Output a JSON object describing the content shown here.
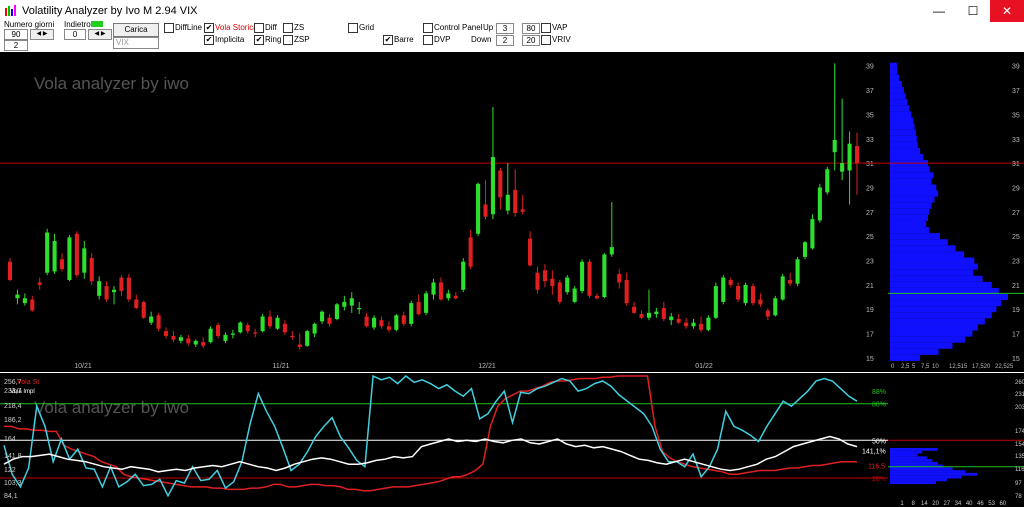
{
  "window": {
    "title": "Volatility Analyzer by Ivo M 2.94  VIX",
    "minimize": "—",
    "maximize": "☐",
    "close": "✕"
  },
  "toolbar": {
    "numero_giorni_label": "Numero giorni",
    "numero_giorni_value": "90",
    "numero_giorni_second": "2",
    "indietro_label": "Indietro",
    "indietro_value": "0",
    "carica_label": "Carica",
    "symbol_placeholder": "VIX",
    "checkboxes": [
      {
        "label": "DiffLine",
        "checked": false,
        "color": "#000000"
      },
      {
        "label": "Vola Storica",
        "checked": true,
        "color": "#e00000"
      },
      {
        "label": "Implicita",
        "checked": true,
        "color": "#000000"
      },
      {
        "label": "Diff",
        "checked": false,
        "color": "#000000"
      },
      {
        "label": "Ring",
        "checked": true,
        "color": "#000000"
      },
      {
        "label": "ZS",
        "checked": false,
        "color": "#000000"
      },
      {
        "label": "ZSP",
        "checked": false,
        "color": "#000000"
      },
      {
        "label": "Grid",
        "checked": false,
        "color": "#000000"
      },
      {
        "label": "Barre",
        "checked": true,
        "color": "#000000"
      },
      {
        "label": "Control Panel",
        "checked": false,
        "color": "#000000"
      },
      {
        "label": "DVP",
        "checked": false,
        "color": "#000000"
      },
      {
        "label": "VAP",
        "checked": false,
        "color": "#000000"
      },
      {
        "label": "VRIV",
        "checked": false,
        "color": "#000000"
      }
    ],
    "up_label": "Up",
    "up_value": "3",
    "up_value2": "80",
    "down_label": "Down",
    "down_value": "2",
    "down_value2": "20"
  },
  "main_chart": {
    "watermark": "Vola analyzer by iwo",
    "y_ticks": [
      "39",
      "37",
      "35",
      "33",
      "31",
      "29",
      "27",
      "25",
      "23",
      "21",
      "19",
      "17",
      "15"
    ],
    "x_labels": [
      "10/21",
      "11/21",
      "12/21",
      "01/22"
    ],
    "current_line_value": 31,
    "secondary_line_value": 20.3,
    "ylim": [
      14.5,
      39.8
    ]
  },
  "profile_chart": {
    "x_ticks": [
      "0",
      "2,5",
      "5",
      "7,5",
      "10",
      "12,515",
      "17,520",
      "22,525"
    ]
  },
  "lower_chart": {
    "watermark": "Vola analyzer by iwo",
    "legend_storica": "Vola St",
    "legend_storica_val": "256,7",
    "legend_implicita": "Vola Impl",
    "y_ticks_left": [
      "256,7",
      "233,7",
      "218,4",
      "186,2",
      "164",
      "141,8",
      "122",
      "103,3",
      "84,1"
    ],
    "pct_labels": [
      "88%",
      "80%",
      "50%",
      "20%"
    ],
    "value_label_white": "141,1%",
    "value_label_red": "116,5",
    "y_ticks_right": [
      "260",
      "231",
      "203",
      "174",
      "154",
      "135",
      "116",
      "97",
      "78"
    ],
    "hist_x_ticks": [
      "1",
      "8",
      "14",
      "20",
      "27",
      "34",
      "40",
      "46",
      "53",
      "60"
    ]
  },
  "colors": {
    "up": "#2ee02e",
    "down": "#e02020",
    "profile": "#1010ff",
    "iv": "#40d0e0",
    "hv": "#e02020",
    "ring": "#ffffff",
    "ref_red": "#c00000",
    "ref_green": "#20c020"
  },
  "chart_data": {
    "type": "candlestick",
    "candles": [
      [
        22.9,
        23.2,
        21.3,
        21.4
      ],
      [
        19.9,
        20.6,
        19.4,
        20.2
      ],
      [
        19.5,
        20.3,
        19.3,
        19.9
      ],
      [
        19.8,
        20.1,
        18.8,
        18.9
      ],
      [
        21.2,
        21.6,
        20.6,
        21.0
      ],
      [
        22.0,
        25.6,
        21.8,
        25.3
      ],
      [
        22.1,
        25.2,
        21.9,
        24.6
      ],
      [
        23.1,
        23.6,
        22.1,
        22.3
      ],
      [
        21.4,
        25.1,
        21.3,
        24.9
      ],
      [
        25.2,
        25.4,
        21.6,
        21.8
      ],
      [
        22.0,
        24.6,
        21.5,
        24.0
      ],
      [
        23.2,
        23.6,
        21.0,
        21.3
      ],
      [
        20.1,
        21.7,
        19.8,
        21.3
      ],
      [
        20.9,
        21.3,
        19.6,
        19.8
      ],
      [
        20.4,
        20.9,
        19.4,
        20.6
      ],
      [
        21.6,
        21.8,
        20.1,
        20.5
      ],
      [
        21.6,
        21.9,
        19.6,
        19.8
      ],
      [
        19.8,
        20.2,
        19.0,
        19.1
      ],
      [
        19.6,
        19.7,
        18.2,
        18.3
      ],
      [
        17.9,
        18.8,
        17.7,
        18.4
      ],
      [
        18.5,
        18.7,
        17.2,
        17.4
      ],
      [
        17.2,
        17.5,
        16.6,
        16.8
      ],
      [
        16.8,
        17.2,
        16.3,
        16.5
      ],
      [
        16.4,
        16.9,
        16.2,
        16.7
      ],
      [
        16.6,
        16.9,
        16.0,
        16.2
      ],
      [
        16.1,
        16.5,
        15.9,
        16.4
      ],
      [
        16.3,
        16.7,
        15.8,
        16.0
      ],
      [
        16.3,
        17.6,
        16.2,
        17.4
      ],
      [
        17.7,
        17.9,
        16.6,
        16.8
      ],
      [
        16.4,
        17.1,
        16.2,
        16.9
      ],
      [
        16.9,
        17.3,
        16.6,
        17.0
      ],
      [
        17.1,
        18.0,
        17.0,
        17.9
      ],
      [
        17.7,
        17.9,
        17.0,
        17.2
      ],
      [
        17.1,
        17.4,
        16.7,
        17.0
      ],
      [
        17.2,
        18.6,
        17.1,
        18.4
      ],
      [
        18.4,
        18.9,
        17.4,
        17.6
      ],
      [
        17.4,
        18.5,
        17.3,
        18.3
      ],
      [
        17.8,
        18.1,
        16.9,
        17.1
      ],
      [
        16.8,
        17.2,
        16.5,
        16.7
      ],
      [
        16.1,
        17.0,
        15.7,
        15.9
      ],
      [
        16.0,
        17.3,
        15.9,
        17.2
      ],
      [
        17.0,
        17.9,
        16.7,
        17.8
      ],
      [
        18.0,
        18.9,
        17.8,
        18.8
      ],
      [
        18.3,
        18.6,
        17.6,
        17.8
      ],
      [
        18.2,
        19.5,
        18.1,
        19.4
      ],
      [
        19.2,
        20.1,
        18.9,
        19.6
      ],
      [
        19.3,
        20.4,
        18.7,
        19.9
      ],
      [
        19.0,
        19.6,
        18.6,
        19.1
      ],
      [
        18.4,
        18.7,
        17.5,
        17.6
      ],
      [
        17.5,
        18.5,
        17.3,
        18.3
      ],
      [
        18.1,
        18.4,
        17.4,
        17.6
      ],
      [
        17.6,
        18.0,
        17.1,
        17.3
      ],
      [
        17.3,
        18.6,
        17.2,
        18.5
      ],
      [
        18.5,
        18.8,
        17.6,
        17.8
      ],
      [
        17.8,
        19.7,
        17.6,
        19.5
      ],
      [
        19.6,
        20.2,
        18.5,
        18.6
      ],
      [
        18.7,
        20.5,
        18.5,
        20.3
      ],
      [
        20.2,
        21.5,
        19.8,
        21.2
      ],
      [
        21.2,
        21.6,
        19.7,
        19.8
      ],
      [
        19.9,
        20.6,
        19.7,
        20.3
      ],
      [
        20.1,
        20.4,
        19.8,
        19.9
      ],
      [
        20.6,
        23.2,
        20.4,
        22.9
      ],
      [
        24.9,
        25.5,
        22.3,
        22.5
      ],
      [
        25.2,
        29.4,
        25.0,
        29.3
      ],
      [
        27.6,
        29.6,
        26.4,
        26.6
      ],
      [
        26.8,
        35.6,
        26.4,
        31.5
      ],
      [
        30.4,
        30.6,
        27.2,
        28.2
      ],
      [
        27.1,
        31.0,
        26.8,
        28.4
      ],
      [
        28.8,
        30.5,
        26.6,
        26.9
      ],
      [
        27.2,
        28.4,
        26.8,
        27.0
      ],
      [
        24.8,
        25.4,
        22.5,
        22.6
      ],
      [
        22.0,
        22.5,
        20.3,
        20.6
      ],
      [
        22.2,
        22.7,
        20.8,
        21.3
      ],
      [
        21.5,
        22.2,
        20.2,
        20.9
      ],
      [
        21.2,
        21.4,
        19.4,
        19.6
      ],
      [
        20.4,
        21.8,
        20.2,
        21.6
      ],
      [
        19.6,
        20.9,
        19.5,
        20.7
      ],
      [
        20.5,
        23.1,
        20.3,
        22.9
      ],
      [
        22.9,
        23.1,
        19.9,
        20.1
      ],
      [
        20.1,
        20.3,
        19.8,
        19.9
      ],
      [
        20.0,
        23.6,
        19.9,
        23.5
      ],
      [
        23.5,
        27.8,
        23.3,
        24.1
      ],
      [
        21.9,
        22.3,
        20.7,
        21.2
      ],
      [
        21.4,
        22.0,
        19.3,
        19.5
      ],
      [
        19.2,
        19.6,
        18.6,
        18.7
      ],
      [
        18.6,
        18.9,
        18.2,
        18.3
      ],
      [
        18.3,
        20.6,
        18.1,
        18.7
      ],
      [
        18.6,
        19.1,
        18.3,
        18.8
      ],
      [
        19.1,
        19.6,
        18.0,
        18.2
      ],
      [
        18.1,
        18.7,
        17.7,
        18.4
      ],
      [
        18.2,
        18.6,
        17.8,
        17.9
      ],
      [
        17.9,
        18.3,
        17.4,
        17.6
      ],
      [
        17.6,
        18.2,
        17.4,
        17.9
      ],
      [
        17.8,
        18.4,
        17.1,
        17.3
      ],
      [
        17.3,
        18.5,
        17.2,
        18.3
      ],
      [
        18.3,
        21.2,
        18.2,
        20.9
      ],
      [
        19.6,
        21.8,
        19.4,
        21.6
      ],
      [
        21.4,
        21.6,
        20.8,
        21.0
      ],
      [
        20.9,
        21.2,
        19.6,
        19.8
      ],
      [
        19.5,
        21.2,
        19.3,
        21.0
      ],
      [
        20.9,
        21.1,
        19.3,
        19.5
      ],
      [
        19.8,
        20.3,
        19.2,
        19.4
      ],
      [
        18.9,
        19.1,
        18.1,
        18.4
      ],
      [
        18.5,
        20.1,
        18.4,
        19.9
      ],
      [
        19.8,
        21.9,
        19.7,
        21.7
      ],
      [
        21.4,
        22.0,
        20.9,
        21.1
      ],
      [
        21.1,
        23.3,
        20.9,
        23.1
      ],
      [
        23.3,
        24.6,
        23.1,
        24.5
      ],
      [
        24.0,
        26.8,
        23.9,
        26.4
      ],
      [
        26.3,
        29.3,
        26.1,
        29.0
      ],
      [
        28.6,
        30.7,
        28.4,
        30.5
      ],
      [
        31.9,
        39.2,
        30.4,
        32.9
      ],
      [
        30.3,
        36.3,
        29.6,
        31.0
      ],
      [
        30.4,
        33.6,
        27.6,
        32.6
      ],
      [
        32.4,
        33.5,
        28.4,
        31.0
      ]
    ],
    "profile": [
      [
        39.0,
        1.5
      ],
      [
        38.5,
        1.6
      ],
      [
        38.0,
        2.0
      ],
      [
        37.5,
        2.6
      ],
      [
        37.0,
        3.0
      ],
      [
        36.5,
        3.4
      ],
      [
        36.0,
        3.8
      ],
      [
        35.5,
        4.2
      ],
      [
        35.0,
        4.6
      ],
      [
        34.5,
        5.0
      ],
      [
        34.0,
        5.3
      ],
      [
        33.5,
        5.6
      ],
      [
        33.0,
        5.8
      ],
      [
        32.5,
        6.0
      ],
      [
        32.0,
        6.5
      ],
      [
        31.5,
        7.2
      ],
      [
        31.0,
        8.2
      ],
      [
        30.5,
        8.6
      ],
      [
        30.0,
        9.4
      ],
      [
        29.5,
        9.0
      ],
      [
        29.0,
        10.0
      ],
      [
        28.5,
        10.4
      ],
      [
        28.0,
        9.6
      ],
      [
        27.5,
        9.0
      ],
      [
        27.0,
        8.5
      ],
      [
        26.5,
        8.2
      ],
      [
        26.0,
        7.8
      ],
      [
        25.5,
        8.5
      ],
      [
        25.0,
        10.8
      ],
      [
        24.5,
        12.5
      ],
      [
        24.0,
        14.2
      ],
      [
        23.5,
        16.0
      ],
      [
        23.0,
        18.2
      ],
      [
        22.5,
        19.0
      ],
      [
        22.0,
        18.0
      ],
      [
        21.5,
        20.0
      ],
      [
        21.0,
        22.0
      ],
      [
        20.5,
        23.5
      ],
      [
        20.0,
        25.5
      ],
      [
        19.5,
        24.0
      ],
      [
        19.0,
        23.0
      ],
      [
        18.5,
        22.0
      ],
      [
        18.0,
        20.5
      ],
      [
        17.5,
        19.0
      ],
      [
        17.0,
        17.8
      ],
      [
        16.5,
        16.2
      ],
      [
        16.0,
        13.5
      ],
      [
        15.5,
        10.5
      ],
      [
        15.0,
        6.5
      ]
    ],
    "iv_series": [
      0.45,
      0.22,
      0.12,
      0.27,
      0.76,
      0.6,
      0.32,
      0.5,
      0.34,
      0.42,
      0.27,
      0.26,
      0.12,
      0.28,
      0.12,
      0.16,
      0.22,
      0.13,
      0.14,
      0.18,
      0.05,
      0.17,
      0.15,
      0.28,
      0.17,
      0.18,
      0.25,
      0.11,
      0.16,
      0.32,
      0.62,
      0.86,
      0.72,
      0.6,
      0.43,
      0.25,
      0.3,
      0.4,
      0.52,
      0.6,
      0.67,
      0.52,
      0.43,
      0.33,
      0.28,
      1.0,
      0.97,
      0.99,
      0.94,
      1.0,
      0.95,
      0.97,
      0.94,
      0.9,
      0.93,
      0.88,
      0.84,
      0.9,
      0.66,
      0.7,
      0.8,
      0.88,
      0.63,
      0.87,
      0.86,
      0.9,
      0.92,
      0.95,
      0.98,
      0.96,
      0.88,
      0.9,
      0.94,
      0.96,
      0.92,
      0.85,
      0.8,
      0.75,
      0.7,
      0.6,
      0.42,
      0.32,
      0.32,
      0.28,
      0.38,
      0.2,
      0.28,
      0.42,
      0.72,
      0.6,
      0.57,
      0.53,
      0.48,
      0.6,
      0.7,
      0.8,
      0.76,
      0.82,
      0.88,
      0.96,
      0.98,
      0.96,
      0.9,
      0.84,
      0.8
    ],
    "hv_series": [
      0.6,
      0.6,
      0.58,
      0.58,
      0.57,
      0.57,
      0.56,
      0.56,
      0.45,
      0.42,
      0.4,
      0.38,
      0.36,
      0.32,
      0.3,
      0.28,
      0.22,
      0.2,
      0.19,
      0.18,
      0.17,
      0.16,
      0.15,
      0.14,
      0.13,
      0.12,
      0.12,
      0.12,
      0.11,
      0.11,
      0.1,
      0.1,
      0.1,
      0.11,
      0.11,
      0.12,
      0.14,
      0.14,
      0.12,
      0.12,
      0.13,
      0.14,
      0.14,
      0.13,
      0.13,
      0.12,
      0.1,
      0.1,
      0.09,
      0.09,
      0.1,
      0.11,
      0.12,
      0.12,
      0.12,
      0.13,
      0.14,
      0.15,
      0.16,
      0.18,
      0.2,
      0.2,
      0.22,
      0.25,
      0.3,
      0.6,
      0.76,
      0.82,
      0.85,
      0.88,
      0.88,
      0.9,
      0.92,
      0.95,
      0.96,
      0.96,
      0.97,
      0.98,
      0.98,
      0.98,
      0.99,
      0.99,
      1.0,
      1.0,
      1.0,
      1.0,
      1.0,
      0.6,
      0.4,
      0.35,
      0.32,
      0.3,
      0.28,
      0.27,
      0.26,
      0.25,
      0.24,
      0.22,
      0.22,
      0.23,
      0.24,
      0.25,
      0.25,
      0.25,
      0.26,
      0.27,
      0.27,
      0.28,
      0.29,
      0.29,
      0.3,
      0.31,
      0.32,
      0.32,
      0.32
    ],
    "ring_series": [
      0.3,
      0.34,
      0.36,
      0.36,
      0.37,
      0.38,
      0.36,
      0.34,
      0.33,
      0.32,
      0.3,
      0.28,
      0.27,
      0.26,
      0.28,
      0.27,
      0.26,
      0.24,
      0.25,
      0.26,
      0.25,
      0.27,
      0.28,
      0.29,
      0.28,
      0.3,
      0.32,
      0.3,
      0.28,
      0.27,
      0.25,
      0.27,
      0.3,
      0.32,
      0.34,
      0.35,
      0.34,
      0.32,
      0.3,
      0.3,
      0.31,
      0.33,
      0.34,
      0.36,
      0.35,
      0.36,
      0.44,
      0.46,
      0.48,
      0.5,
      0.48,
      0.49,
      0.48,
      0.5,
      0.48,
      0.47,
      0.49,
      0.5,
      0.47,
      0.46,
      0.48,
      0.5,
      0.46,
      0.44,
      0.45,
      0.43,
      0.44,
      0.42,
      0.4,
      0.37,
      0.34,
      0.33,
      0.31,
      0.3,
      0.32,
      0.34,
      0.32,
      0.3,
      0.28,
      0.26,
      0.25,
      0.26,
      0.28,
      0.3,
      0.34,
      0.36,
      0.4,
      0.44,
      0.46,
      0.48,
      0.5,
      0.52,
      0.5,
      0.46,
      0.44
    ],
    "hist": [
      [
        154,
        0.52
      ],
      [
        150,
        0.35
      ],
      [
        146,
        0.3
      ],
      [
        142,
        0.4
      ],
      [
        138,
        0.46
      ],
      [
        134,
        0.52
      ],
      [
        130,
        0.58
      ],
      [
        126,
        0.68
      ],
      [
        122,
        0.82
      ],
      [
        118,
        0.95
      ],
      [
        114,
        0.78
      ],
      [
        110,
        0.62
      ],
      [
        106,
        0.5
      ]
    ]
  }
}
